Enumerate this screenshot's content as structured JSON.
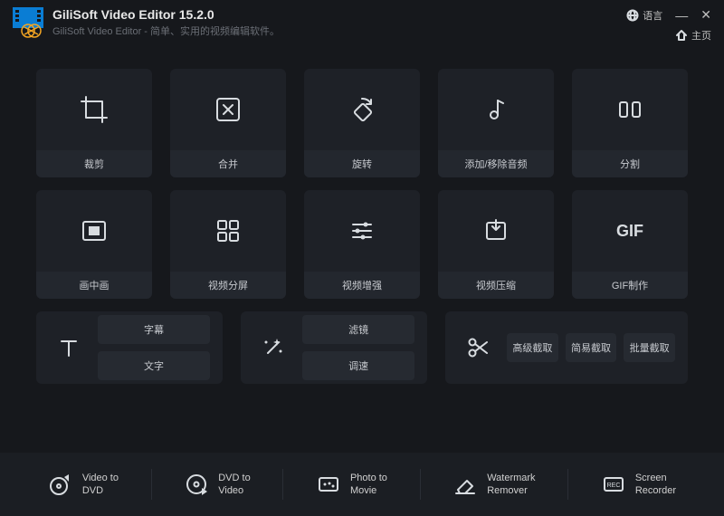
{
  "header": {
    "title": "GiliSoft Video Editor 15.2.0",
    "subtitle": "GiliSoft Video Editor - 简单、实用的视频编辑软件。",
    "language": "语言",
    "home": "主页"
  },
  "tiles": {
    "crop": "裁剪",
    "merge": "合并",
    "rotate": "旋转",
    "audio": "添加/移除音频",
    "split": "分割",
    "pip": "画中画",
    "vsplit": "视频分屏",
    "enhance": "视频增强",
    "compress": "视频压缩",
    "gif": "GIF制作"
  },
  "text_tile": {
    "subtitle": "字幕",
    "text": "文字"
  },
  "effect_tile": {
    "filter": "滤镜",
    "adjust": "调速"
  },
  "cut_tile": {
    "advanced": "高级截取",
    "simple": "简易截取",
    "batch": "批量截取"
  },
  "footer": {
    "vid2dvd": "Video to\nDVD",
    "dvd2vid": "DVD to\nVideo",
    "photo": "Photo to\nMovie",
    "watermark": "Watermark\nRemover",
    "screen": "Screen\nRecorder"
  }
}
